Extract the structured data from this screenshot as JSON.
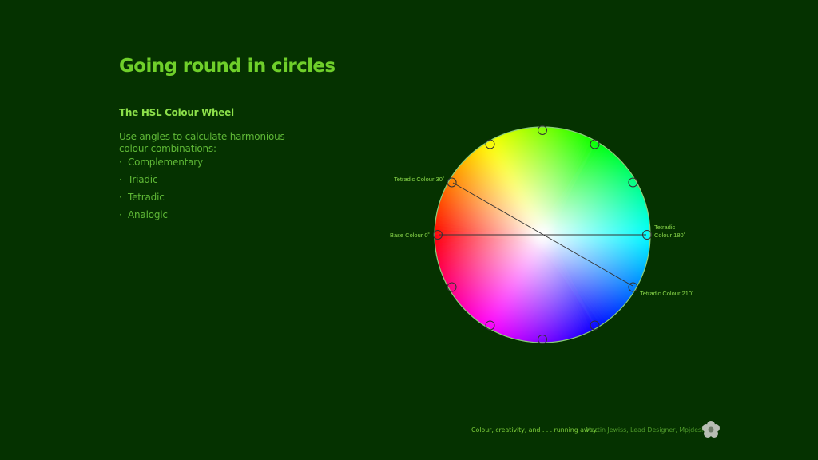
{
  "slide": {
    "title": "Going round in circles",
    "subtitle": "The HSL Colour Wheel",
    "intro": "Use angles to calculate harmonious colour combinations:",
    "bullets": [
      "Complementary",
      "Triadic",
      "Tetradic",
      "Analogic"
    ]
  },
  "wheel": {
    "labels": {
      "tetradic_30": "Tetradic Colour 30˚",
      "base_0": "Base Colour 0˚",
      "tetradic_180_line1": "Tetradic",
      "tetradic_180_line2": "Colour 180˚",
      "tetradic_210": "Tetradic Colour 210˚"
    }
  },
  "footer": {
    "tagline": "Colour, creativity, and . . . running away.",
    "author": "Martin Jewiss, Lead Designer, Mpjdesign"
  },
  "colors": {
    "background": "#053200",
    "title": "#6fcf2a",
    "text": "#5fb836"
  },
  "icons": {
    "logo": "flower-logo-icon"
  }
}
